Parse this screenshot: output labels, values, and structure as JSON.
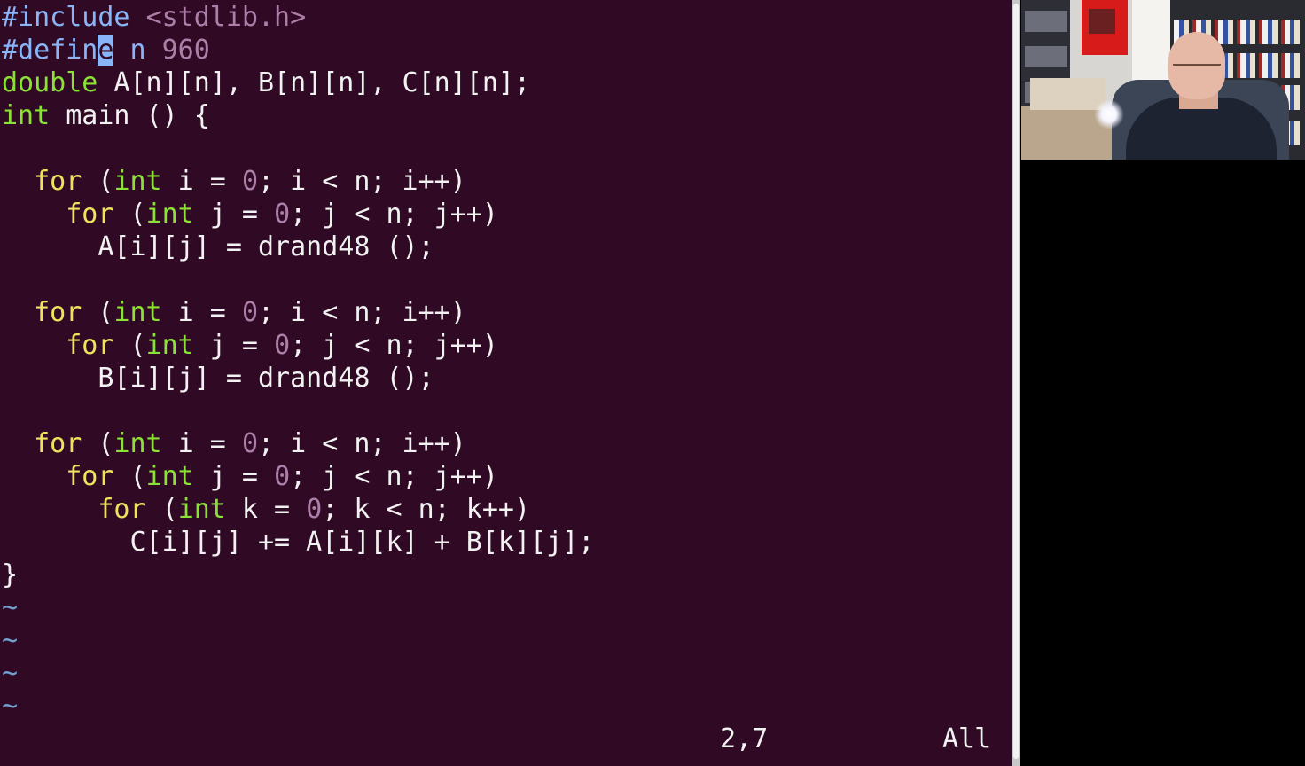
{
  "editor": {
    "lines": [
      [
        {
          "t": "#include",
          "c": "pre"
        },
        {
          "t": " ",
          "c": ""
        },
        {
          "t": "<stdlib.h>",
          "c": "str"
        }
      ],
      [
        {
          "t": "#defin",
          "c": "pre"
        },
        {
          "t": "e",
          "c": "cursor"
        },
        {
          "t": " n ",
          "c": "pre"
        },
        {
          "t": "960",
          "c": "num"
        }
      ],
      [
        {
          "t": "double",
          "c": "ty"
        },
        {
          "t": " A[n][n], B[n][n], C[n][n];",
          "c": ""
        }
      ],
      [
        {
          "t": "int",
          "c": "ty"
        },
        {
          "t": " main () {",
          "c": ""
        }
      ],
      [],
      [
        {
          "t": "  ",
          "c": ""
        },
        {
          "t": "for",
          "c": "kw"
        },
        {
          "t": " (",
          "c": ""
        },
        {
          "t": "int",
          "c": "ty"
        },
        {
          "t": " i = ",
          "c": ""
        },
        {
          "t": "0",
          "c": "num"
        },
        {
          "t": "; i < n; i++)",
          "c": ""
        }
      ],
      [
        {
          "t": "    ",
          "c": ""
        },
        {
          "t": "for",
          "c": "kw"
        },
        {
          "t": " (",
          "c": ""
        },
        {
          "t": "int",
          "c": "ty"
        },
        {
          "t": " j = ",
          "c": ""
        },
        {
          "t": "0",
          "c": "num"
        },
        {
          "t": "; j < n; j++)",
          "c": ""
        }
      ],
      [
        {
          "t": "      A[i][j] = drand48 ();",
          "c": ""
        }
      ],
      [],
      [
        {
          "t": "  ",
          "c": ""
        },
        {
          "t": "for",
          "c": "kw"
        },
        {
          "t": " (",
          "c": ""
        },
        {
          "t": "int",
          "c": "ty"
        },
        {
          "t": " i = ",
          "c": ""
        },
        {
          "t": "0",
          "c": "num"
        },
        {
          "t": "; i < n; i++)",
          "c": ""
        }
      ],
      [
        {
          "t": "    ",
          "c": ""
        },
        {
          "t": "for",
          "c": "kw"
        },
        {
          "t": " (",
          "c": ""
        },
        {
          "t": "int",
          "c": "ty"
        },
        {
          "t": " j = ",
          "c": ""
        },
        {
          "t": "0",
          "c": "num"
        },
        {
          "t": "; j < n; j++)",
          "c": ""
        }
      ],
      [
        {
          "t": "      B[i][j] = drand48 ();",
          "c": ""
        }
      ],
      [],
      [
        {
          "t": "  ",
          "c": ""
        },
        {
          "t": "for",
          "c": "kw"
        },
        {
          "t": " (",
          "c": ""
        },
        {
          "t": "int",
          "c": "ty"
        },
        {
          "t": " i = ",
          "c": ""
        },
        {
          "t": "0",
          "c": "num"
        },
        {
          "t": "; i < n; i++)",
          "c": ""
        }
      ],
      [
        {
          "t": "    ",
          "c": ""
        },
        {
          "t": "for",
          "c": "kw"
        },
        {
          "t": " (",
          "c": ""
        },
        {
          "t": "int",
          "c": "ty"
        },
        {
          "t": " j = ",
          "c": ""
        },
        {
          "t": "0",
          "c": "num"
        },
        {
          "t": "; j < n; j++)",
          "c": ""
        }
      ],
      [
        {
          "t": "      ",
          "c": ""
        },
        {
          "t": "for",
          "c": "kw"
        },
        {
          "t": " (",
          "c": ""
        },
        {
          "t": "int",
          "c": "ty"
        },
        {
          "t": " k = ",
          "c": ""
        },
        {
          "t": "0",
          "c": "num"
        },
        {
          "t": "; k < n; k++)",
          "c": ""
        }
      ],
      [
        {
          "t": "        C[i][j] += A[i][k] + B[k][j];",
          "c": ""
        }
      ],
      [
        {
          "t": "}",
          "c": ""
        }
      ],
      [
        {
          "t": "~",
          "c": "tilde"
        }
      ],
      [
        {
          "t": "~",
          "c": "tilde"
        }
      ],
      [
        {
          "t": "~",
          "c": "tilde"
        }
      ],
      [
        {
          "t": "~",
          "c": "tilde"
        }
      ]
    ]
  },
  "status": {
    "position": "2,7",
    "scroll": "All"
  },
  "colors": {
    "background": "#300a24",
    "foreground": "#f2f2f2",
    "preprocessor": "#8ab4f8",
    "keyword": "#f0e25a",
    "type": "#8ae234",
    "number": "#ad7fa8",
    "tilde": "#729fcf"
  },
  "webcam": {
    "label": "presenter-webcam"
  }
}
